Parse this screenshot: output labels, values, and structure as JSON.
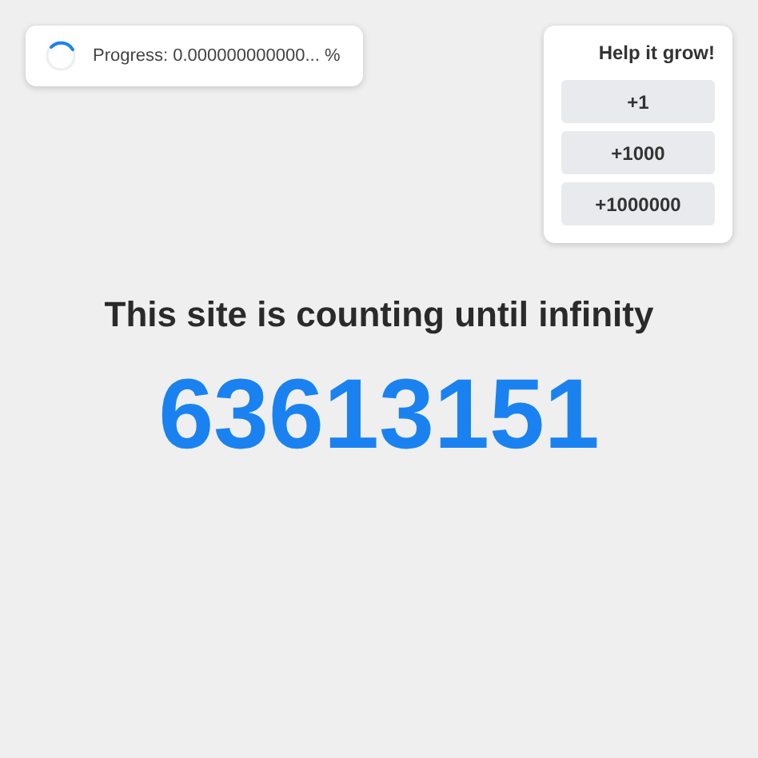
{
  "progress": {
    "label": "Progress: 0.000000000000... %"
  },
  "help": {
    "title": "Help it grow!",
    "buttons": [
      "+1",
      "+1000",
      "+1000000"
    ]
  },
  "heading": "This site is counting until infinity",
  "counter": "63613151"
}
